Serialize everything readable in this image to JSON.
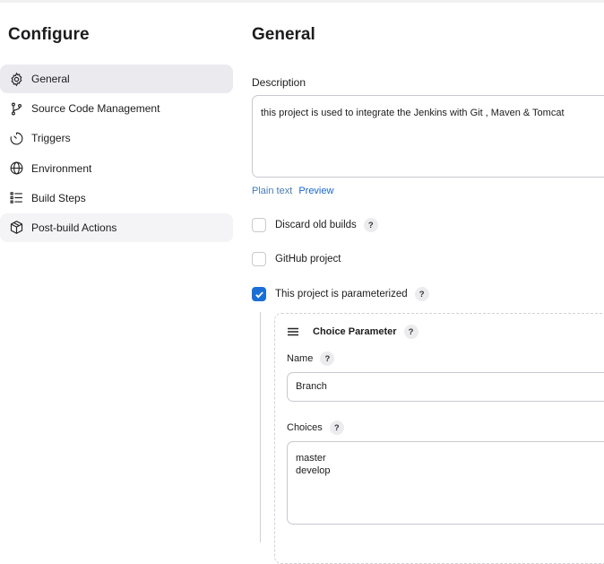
{
  "sidebar": {
    "title": "Configure",
    "items": [
      {
        "label": "General",
        "icon": "gear-icon"
      },
      {
        "label": "Source Code Management",
        "icon": "branch-icon"
      },
      {
        "label": "Triggers",
        "icon": "timer-icon"
      },
      {
        "label": "Environment",
        "icon": "globe-icon"
      },
      {
        "label": "Build Steps",
        "icon": "list-icon"
      },
      {
        "label": "Post-build Actions",
        "icon": "package-icon"
      }
    ]
  },
  "main": {
    "title": "General",
    "description": {
      "label": "Description",
      "value": "this project is used to integrate the Jenkins with Git , Maven & Tomcat",
      "plain_text_link": "Plain text",
      "preview_link": "Preview"
    },
    "options": [
      {
        "label": "Discard old builds",
        "checked": false,
        "help": "?"
      },
      {
        "label": "GitHub project",
        "checked": false
      },
      {
        "label": "This project is parameterized",
        "checked": true,
        "help": "?"
      }
    ],
    "parameter": {
      "title": "Choice Parameter",
      "help": "?",
      "name_label": "Name",
      "name_value": "Branch",
      "choices_label": "Choices",
      "choices_value": "master\ndevelop"
    }
  },
  "colors": {
    "accent": "#1a6fd6",
    "link": "#1a66d2",
    "active_nav_bg": "#ebebef",
    "border": "#c9c9cf"
  }
}
